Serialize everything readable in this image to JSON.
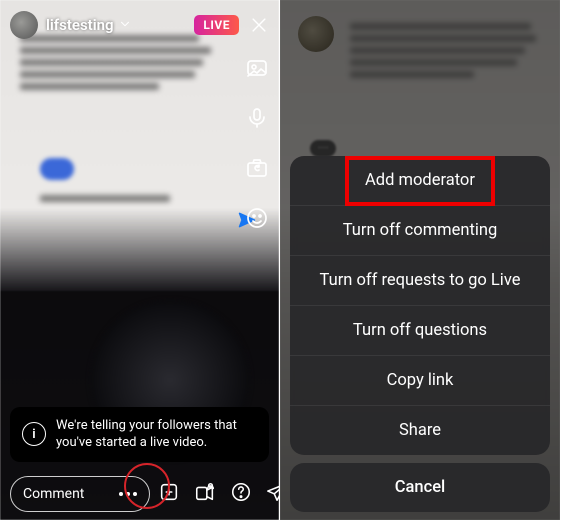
{
  "left": {
    "username": "lifstesting",
    "live_badge": "LIVE",
    "comment_placeholder": "Comment",
    "toast": "We're telling your followers that you've started a live video."
  },
  "right": {
    "menu": {
      "items": [
        "Add moderator",
        "Turn off commenting",
        "Turn off requests to go Live",
        "Turn off questions",
        "Copy link",
        "Share"
      ],
      "cancel": "Cancel"
    }
  }
}
